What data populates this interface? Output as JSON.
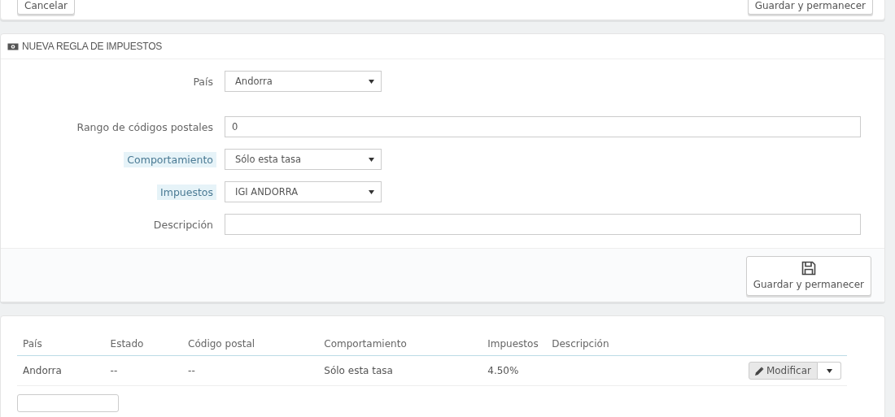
{
  "top_toolbar": {
    "cancel_button": "Cancelar",
    "save_button": "Guardar y permanecer"
  },
  "form_panel": {
    "title": "NUEVA REGLA DE IMPUESTOS",
    "fields": [
      {
        "label": "País",
        "kind": "select",
        "value": "Andorra",
        "hint": false
      },
      {
        "label": "Rango de códigos postales",
        "kind": "text",
        "value": "0",
        "hint": false
      },
      {
        "label": "Comportamiento",
        "kind": "select",
        "value": "Sólo esta tasa",
        "hint": true
      },
      {
        "label": "Impuestos",
        "kind": "select",
        "value": "IGI ANDORRA",
        "hint": true
      },
      {
        "label": "Descripción",
        "kind": "text",
        "hint": false
      }
    ],
    "save_button": "Guardar y permanecer"
  },
  "table": {
    "columns": [
      "País",
      "Estado",
      "Código postal",
      "Comportamiento",
      "Impuestos",
      "Descripción"
    ],
    "rows": [
      {
        "cells": [
          "Andorra",
          "--",
          "--",
          "Sólo esta tasa",
          "4.50%"
        ],
        "action": "Modificar"
      }
    ]
  }
}
